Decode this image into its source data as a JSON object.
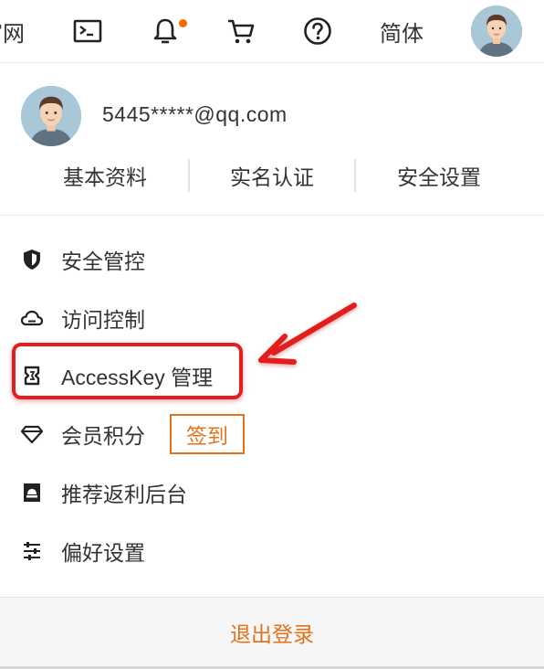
{
  "topbar": {
    "partial_label": "官网",
    "language_label": "简体",
    "icons": [
      "terminal-icon",
      "bell-icon",
      "cart-icon",
      "help-icon"
    ],
    "notification_dot_color": "#f56a00"
  },
  "account": {
    "email": "5445*****@qq.com",
    "quick_links": [
      "基本资料",
      "实名认证",
      "安全设置"
    ]
  },
  "menu": {
    "items": [
      {
        "label": "安全管控",
        "icon": "shield-icon"
      },
      {
        "label": "访问控制",
        "icon": "cloud-icon"
      },
      {
        "label": "AccessKey 管理",
        "icon": "key-card-icon"
      },
      {
        "label": "会员积分",
        "icon": "diamond-icon"
      },
      {
        "label": "推荐返利后台",
        "icon": "rebate-icon"
      },
      {
        "label": "偏好设置",
        "icon": "sliders-icon"
      }
    ],
    "signin_button": "签到"
  },
  "footer": {
    "logout_label": "退出登录"
  },
  "colors": {
    "accent": "#e2731b",
    "annotation": "#e41e1e"
  }
}
